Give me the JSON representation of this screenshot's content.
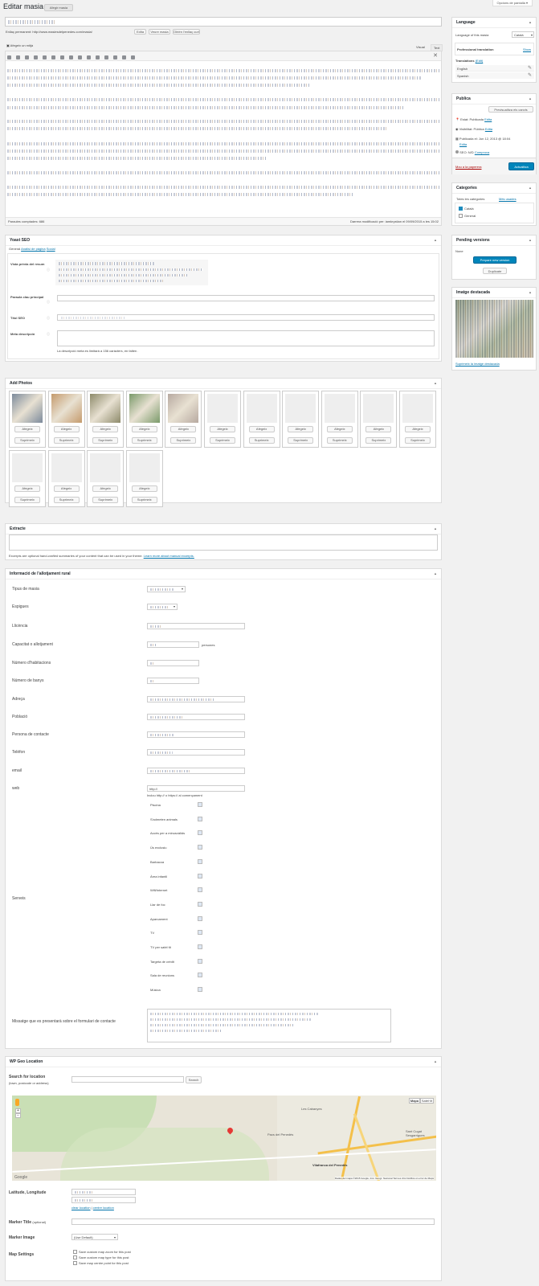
{
  "screen_options": "Opcions de pantalla",
  "page_title": "Editar masia",
  "add_new": "Afegir masia",
  "permalink": {
    "label": "Enllaç permanent:",
    "url": "http://www.masiesdelpenedes.com/masia/",
    "edit": "Edita",
    "view": "Veure masia",
    "shortlink": "Obtén l'enllaç curt"
  },
  "editor": {
    "add_media": "Afegeix un mitjà",
    "tab_visual": "Visual",
    "tab_text": "Text",
    "word_count": "Paraules comptades: 686",
    "last_edited": "Darrera modificació per: iamkrystian el 09/09/2015 a les 15:02"
  },
  "language_box": {
    "title": "Language",
    "label": "Language of this masia",
    "value": "Català",
    "pro_translation": "Professional translation",
    "show": "Show",
    "translations": "Translations",
    "manage": "(Edit)",
    "lang1": "English",
    "lang2": "Spanish"
  },
  "publish_box": {
    "title": "Publica",
    "preview": "Previsualitza els canvis",
    "status": "Estat: Publicada",
    "status_edit": "Edita",
    "visibility": "Visibilitat: Pública",
    "visibility_edit": "Edita",
    "published": "Publicada el: Jun 12, 2013 @ 18:04",
    "published_edit": "Edita",
    "seo": "SEO: N/D",
    "seo_check": "Comprova",
    "trash": "Mou a la paperera",
    "update": "Actualitza"
  },
  "categories_box": {
    "title": "Categories",
    "tab_all": "Totes les categories",
    "tab_used": "Més usades",
    "items": [
      {
        "label": "Català",
        "checked": true
      },
      {
        "label": "General",
        "checked": false
      }
    ]
  },
  "pending_box": {
    "title": "Pending versions",
    "none": "None",
    "prepare": "Prepare new version",
    "duplicate": "Duplicate"
  },
  "featured_box": {
    "title": "Imatge destacada",
    "remove": "Suprimeix la imatge destacada"
  },
  "yoast": {
    "title": "Yoast SEO",
    "tabs": [
      "General",
      "Anàlisi de pàgina",
      "Social"
    ],
    "snippet_label": "Vista prèvia del resum",
    "focus_label": "Paraula clau principal",
    "seo_title_label": "Títol SEO",
    "meta_label": "Meta descripció",
    "meta_note": "La descripció meta es limitarà a 156 caràcters, en falten ."
  },
  "photos": {
    "title": "Add Photos",
    "choose": "Afegeix",
    "delete": "Suprimeix",
    "count": 15,
    "filled": 5
  },
  "excerpt": {
    "title": "Extracte",
    "note": "Excerpts are optional hand-crafted summaries of your content that can be used in your theme.",
    "link": "Learn more about manual excerpts."
  },
  "info": {
    "title": "Informació de l'allotjament rural",
    "fields": [
      "Tipus de masia",
      "Espigues",
      "Llicència",
      "Capacitat o allotjament",
      "Número d'habitacions",
      "Número de banys",
      "Adreça",
      "Població",
      "Persona de contacte",
      "Telèfon",
      "email",
      "web"
    ],
    "capacity_suffix": "persones",
    "web_value": "http://",
    "web_help": "Inclou http:// o https:// al començament",
    "services_label": "Serveis",
    "services": [
      "Piscina",
      "S'admeten animals",
      "Accés per a minusvàlids",
      "Ús exclusiu",
      "Barbacoa",
      "Àrea infantil",
      "Wifi/Internet",
      "Llar de foc",
      "Aparcament",
      "TV",
      "TV per satèl·lit",
      "Targeta de crèdit",
      "Sala de reunions",
      "Música"
    ],
    "message_label": "Missatge que es presentarà sobre el formulari de contacte"
  },
  "geo": {
    "title": "WP Geo Location",
    "search_label": "Search for location",
    "search_hint": "(town, postcode or address)",
    "search_btn": "Search",
    "map_btn": "Mapa",
    "sat_btn": "Satèl·lit",
    "map_town": "Vilafranca del Penedès",
    "map_labels": [
      "Les Cabanyes",
      "Pacs del Penedès",
      "Sant Cugat Sesgarrigues"
    ],
    "map_credit": "Dades del mapa ©2015 Google, Inst. Geogr. Nacional  Termes d'ús  Notifica un error de Maps",
    "google": "Google",
    "latlng_label": "Latitude, Longitude",
    "clear": "clear location",
    "centre": "centre location",
    "marker_title_label": "Marker Title",
    "marker_title_opt": "(optional)",
    "marker_image_label": "Marker Image",
    "marker_image_value": "(Use Default)",
    "settings_label": "Map Settings",
    "settings": [
      "Save custom map zoom for this post",
      "Save custom map type for this post",
      "Save map centre point for this post"
    ]
  }
}
